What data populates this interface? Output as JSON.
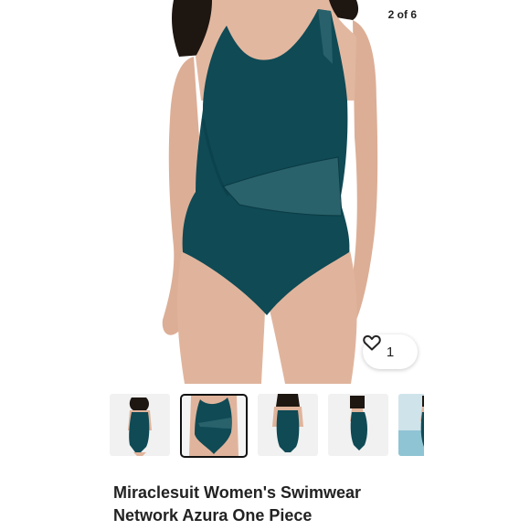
{
  "gallery": {
    "counter": "2 of 6",
    "like_count": "1",
    "main_image_icon": "swimsuit-photo",
    "thumbnails": [
      {
        "view": "front-model",
        "selected": false
      },
      {
        "view": "front-closeup",
        "selected": true
      },
      {
        "view": "back",
        "selected": false
      },
      {
        "view": "side",
        "selected": false
      },
      {
        "view": "poolside",
        "selected": false
      }
    ]
  },
  "product": {
    "title_line1": "Miraclesuit Women's Swimwear",
    "title_line2": "Network Azura One Piece"
  },
  "colors": {
    "swimsuit": "#0f4a55",
    "skin": "#e0b49c",
    "hair": "#1e1611"
  }
}
